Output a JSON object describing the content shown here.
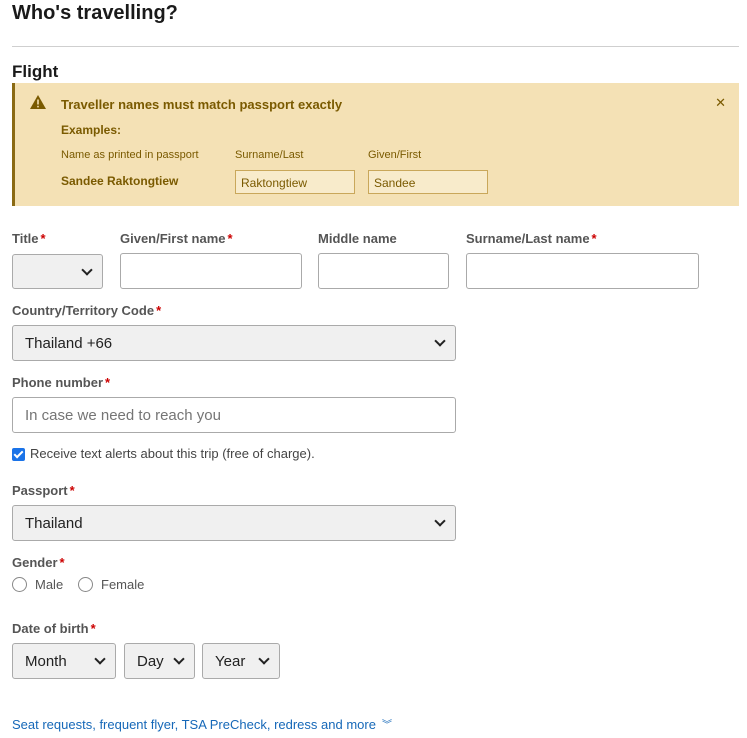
{
  "page": {
    "title": "Who's travelling?"
  },
  "section": {
    "title": "Flight"
  },
  "alert": {
    "title": "Traveller names must match passport exactly",
    "examples_label": "Examples:",
    "col_name_printed": "Name as printed in passport",
    "col_surname": "Surname/Last",
    "col_given": "Given/First",
    "example_full_name": "Sandee Raktongtiew",
    "example_surname": "Raktongtiew",
    "example_given": "Sandee"
  },
  "form": {
    "title_label": "Title",
    "given_label": "Given/First name",
    "middle_label": "Middle name",
    "surname_label": "Surname/Last name",
    "country_code_label": "Country/Territory Code",
    "country_code_value": "Thailand +66",
    "phone_label": "Phone number",
    "phone_placeholder": "In case we need to reach you",
    "sms_alerts_label": "Receive text alerts about this trip (free of charge).",
    "passport_label": "Passport",
    "passport_value": "Thailand",
    "gender_label": "Gender",
    "gender_male": "Male",
    "gender_female": "Female",
    "dob_label": "Date of birth",
    "dob_month": "Month",
    "dob_day": "Day",
    "dob_year": "Year",
    "required_mark": "*"
  },
  "links": {
    "more": "Seat requests, frequent flyer, TSA PreCheck, redress and more"
  },
  "colors": {
    "alert_bg": "#f4e1b5",
    "alert_text": "#7a5a00",
    "link": "#1668b8",
    "required": "#cc0000",
    "checkbox": "#1a73e8"
  }
}
